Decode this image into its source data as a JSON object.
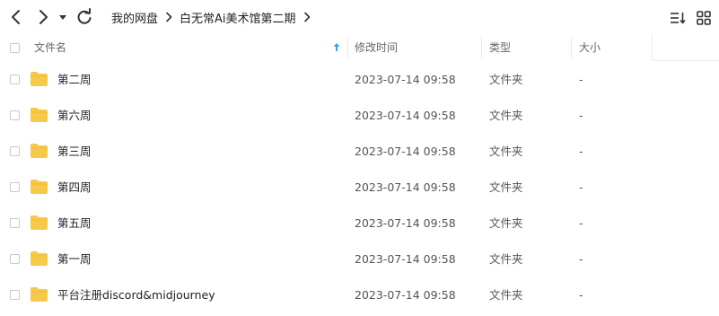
{
  "breadcrumb": [
    "我的网盘",
    "白无常Ai美术馆第二期"
  ],
  "header": {
    "name": "文件名",
    "modified": "修改时间",
    "type": "类型",
    "size": "大小"
  },
  "files": [
    {
      "name": "第二周",
      "modified": "2023-07-14 09:58",
      "type": "文件夹",
      "size": "-"
    },
    {
      "name": "第六周",
      "modified": "2023-07-14 09:58",
      "type": "文件夹",
      "size": "-"
    },
    {
      "name": "第三周",
      "modified": "2023-07-14 09:58",
      "type": "文件夹",
      "size": "-"
    },
    {
      "name": "第四周",
      "modified": "2023-07-14 09:58",
      "type": "文件夹",
      "size": "-"
    },
    {
      "name": "第五周",
      "modified": "2023-07-14 09:58",
      "type": "文件夹",
      "size": "-"
    },
    {
      "name": "第一周",
      "modified": "2023-07-14 09:58",
      "type": "文件夹",
      "size": "-"
    },
    {
      "name": "平台注册discord&midjourney",
      "modified": "2023-07-14 09:58",
      "type": "文件夹",
      "size": "-"
    }
  ],
  "icons": {
    "back": "chevron-left-icon",
    "forward": "chevron-right-icon",
    "history": "caret-down-icon",
    "refresh": "refresh-icon",
    "sort": "sort-icon",
    "view": "grid-view-icon",
    "sort_indicator": "arrow-up-icon",
    "folder": "folder-icon"
  },
  "colors": {
    "folder": "#f7c948",
    "sort_arrow": "#3aa0e6"
  }
}
